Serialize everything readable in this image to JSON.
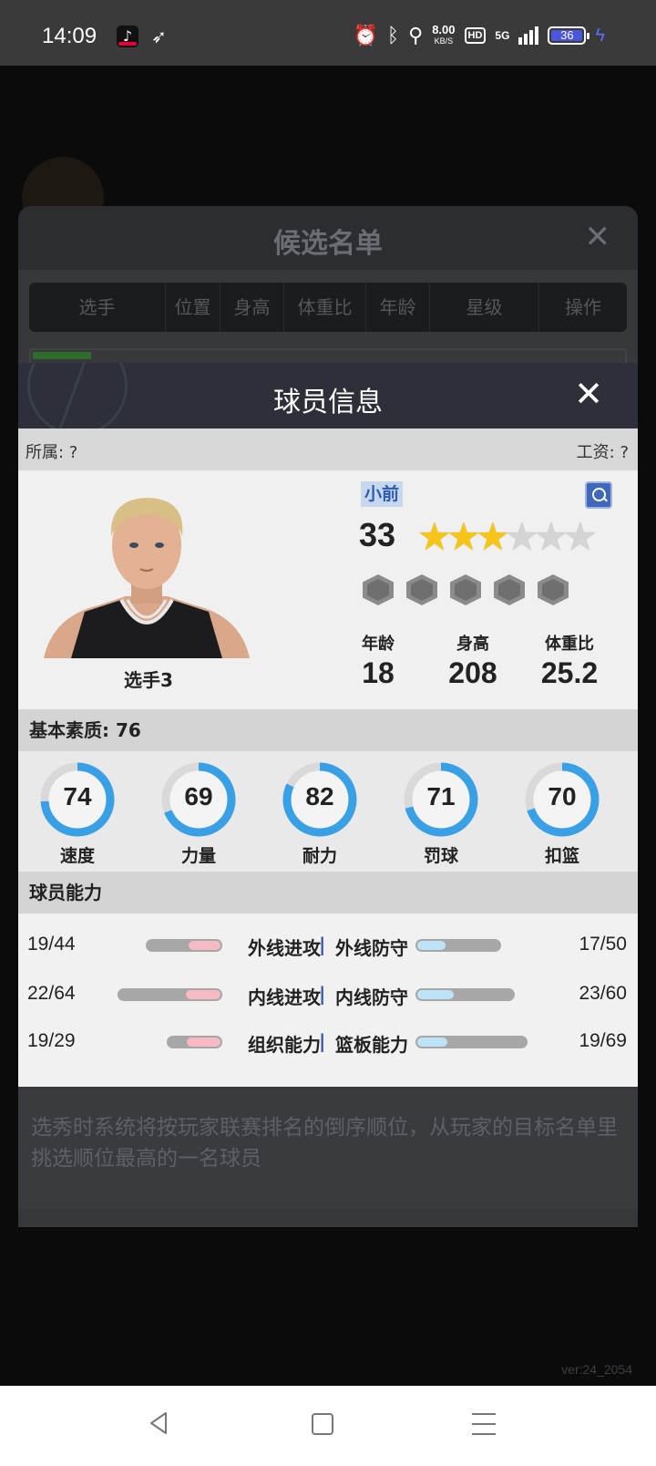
{
  "status_bar": {
    "time": "14:09",
    "speed_value": "8.00",
    "speed_unit": "KB/S",
    "hd": "HD",
    "network": "5G",
    "battery": "36",
    "icons": [
      "tiktok-app-icon",
      "arrow-app-icon",
      "alarm-icon",
      "bluetooth-icon",
      "location-icon",
      "signal-icon",
      "battery-icon",
      "charging-icon"
    ]
  },
  "candidate_list": {
    "title": "候选名单",
    "columns": [
      "选手",
      "位置",
      "身高",
      "体重比",
      "年龄",
      "星级",
      "操作"
    ],
    "note": "选秀时系统将按玩家联赛排名的倒序顺位，从玩家的目标名单里挑选顺位最高的一名球员"
  },
  "player_modal": {
    "title": "球员信息",
    "affiliation": "所属: ?",
    "salary": "工资: ?",
    "name": "选手3",
    "position": "小前",
    "overall": "33",
    "stars_filled": 3,
    "stars_total": 6,
    "bio": [
      {
        "label": "年龄",
        "value": "18"
      },
      {
        "label": "身高",
        "value": "208"
      },
      {
        "label": "体重比",
        "value": "25.2"
      }
    ],
    "basic_title": "基本素质: 76",
    "attributes": [
      {
        "label": "速度",
        "value": 74
      },
      {
        "label": "力量",
        "value": 69
      },
      {
        "label": "耐力",
        "value": 82
      },
      {
        "label": "罚球",
        "value": 71
      },
      {
        "label": "扣篮",
        "value": 70
      }
    ],
    "abilities_title": "球员能力",
    "abilities": [
      {
        "left_value": "19/44",
        "left_label": "外线进攻",
        "separator": "|",
        "right_label": "外线防守",
        "right_value": "17/50"
      },
      {
        "left_value": "22/64",
        "left_label": "内线进攻",
        "separator": "|",
        "right_label": "内线防守",
        "right_value": "23/60"
      },
      {
        "left_value": "19/29",
        "left_label": "组织能力",
        "separator": "|",
        "right_label": "篮板能力",
        "right_value": "19/69"
      }
    ]
  },
  "version": "ver:24_2054",
  "colors": {
    "ring_fill": "#3aa0e6",
    "ring_track": "#d9d9d9",
    "attack_bar": "#f6bac2",
    "defense_bar": "#bfe3f6",
    "modal_header": "#2d3038"
  }
}
